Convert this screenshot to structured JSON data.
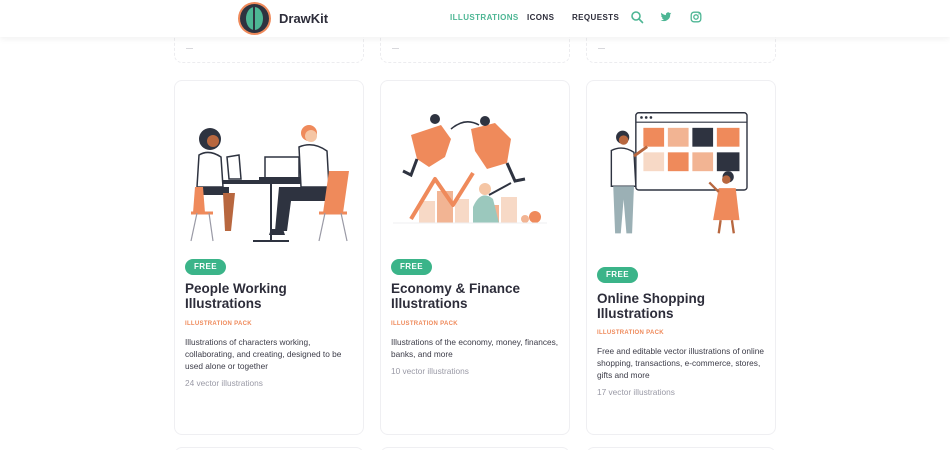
{
  "brand": {
    "name": "DrawKit"
  },
  "nav": {
    "illustrations": "ILLUSTRATIONS",
    "icons": "ICONS",
    "requests": "REQUESTS"
  },
  "icons": {
    "search": "search-icon",
    "twitter": "twitter-icon",
    "instagram": "instagram-icon"
  },
  "colors": {
    "accent_green": "#3bb489",
    "accent_orange": "#ef8a5b",
    "text_dark": "#2d2d3a",
    "text_muted": "#9a9aa6"
  },
  "cards": [
    {
      "badge": "FREE",
      "title": "People Working Illustrations",
      "type": "ILLUSTRATION PACK",
      "description": "Illustrations of characters working, collaborating, and creating, designed to be used alone or together",
      "count": "24 vector illustrations"
    },
    {
      "badge": "FREE",
      "title": "Economy & Finance Illustrations",
      "type": "ILLUSTRATION PACK",
      "description": "Illustrations of the economy, money, finances, banks, and more",
      "count": "10 vector illustrations"
    },
    {
      "badge": "FREE",
      "title": "Online Shopping Illustrations",
      "type": "ILLUSTRATION PACK",
      "description": "Free and editable vector illustrations of online shopping, transactions, e-commerce, stores, gifts and more",
      "count": "17 vector illustrations"
    }
  ]
}
